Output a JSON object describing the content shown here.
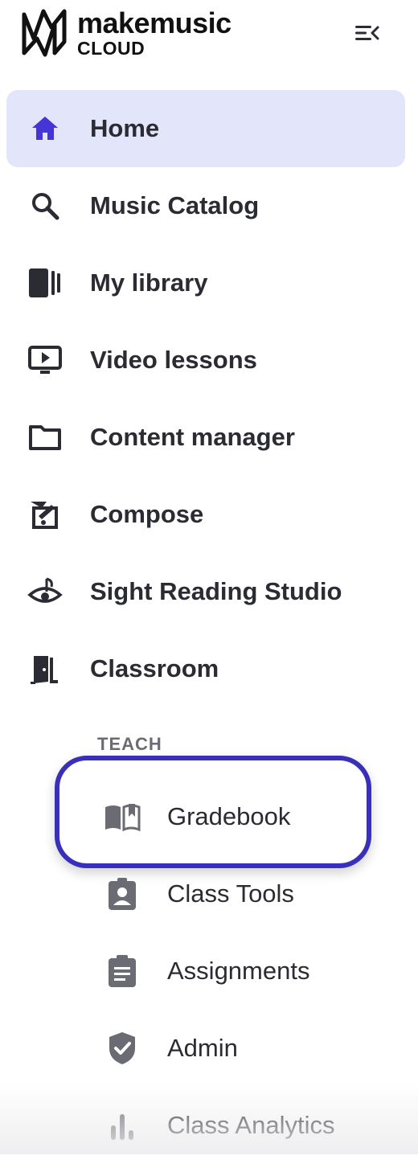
{
  "brand": {
    "name": "makemusic",
    "sub": "CLOUD"
  },
  "header": {
    "collapse_icon": "menu-collapse-icon"
  },
  "nav": {
    "items": [
      {
        "label": "Home",
        "icon": "home-icon",
        "active": true
      },
      {
        "label": "Music Catalog",
        "icon": "search-icon",
        "active": false
      },
      {
        "label": "My library",
        "icon": "library-icon",
        "active": false
      },
      {
        "label": "Video lessons",
        "icon": "video-icon",
        "active": false
      },
      {
        "label": "Content manager",
        "icon": "folder-icon",
        "active": false
      },
      {
        "label": "Compose",
        "icon": "compose-icon",
        "active": false
      },
      {
        "label": "Sight Reading Studio",
        "icon": "eye-music-icon",
        "active": false
      },
      {
        "label": "Classroom",
        "icon": "door-icon",
        "active": false
      }
    ]
  },
  "teach": {
    "section_label": "TEACH",
    "items": [
      {
        "label": "Gradebook",
        "icon": "book-icon",
        "highlighted": true
      },
      {
        "label": "Class Tools",
        "icon": "badge-icon",
        "highlighted": false
      },
      {
        "label": "Assignments",
        "icon": "clipboard-icon",
        "highlighted": false
      },
      {
        "label": "Admin",
        "icon": "shield-check-icon",
        "highlighted": false
      },
      {
        "label": "Class Analytics",
        "icon": "bar-chart-icon",
        "highlighted": false
      }
    ]
  },
  "colors": {
    "accent": "#4535d6",
    "active_bg": "#e3e6fa",
    "highlight_ring": "#3a2fb8",
    "text": "#2b2b33",
    "muted_icon": "#6b6b73"
  }
}
